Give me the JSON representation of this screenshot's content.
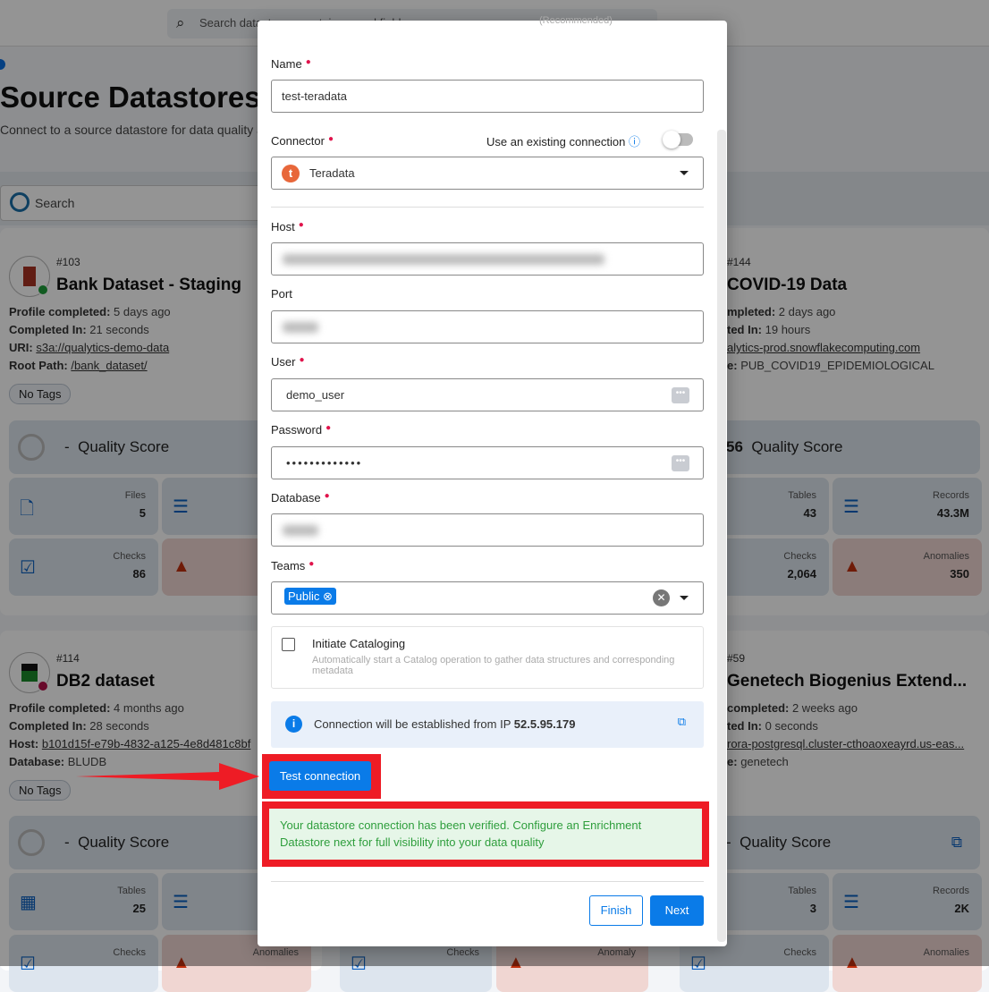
{
  "top_search_placeholder": "Search datastores, containers and fields",
  "page": {
    "title": "Source Datastores",
    "subtitle": "Connect to a source datastore for data quality a",
    "search_placeholder": "Search"
  },
  "cards": [
    {
      "id": "#103",
      "name": "Bank Dataset - Staging",
      "status_color": "#1e9e3a",
      "meta": [
        [
          "Profile completed:",
          "5 days ago"
        ],
        [
          "Completed In:",
          "21 seconds"
        ],
        [
          "URI:",
          "s3a://qualytics-demo-data"
        ],
        [
          "Root Path:",
          "/bank_dataset/"
        ]
      ],
      "tag": "No Tags",
      "quality": "-",
      "quality_label": "Quality Score",
      "tiles": [
        {
          "label": "Files",
          "value": "5",
          "icon": "file-icon"
        },
        {
          "label": "Checks",
          "value": "86",
          "icon": "check-icon"
        }
      ]
    },
    {
      "id": "#114",
      "name": "DB2 dataset",
      "status_color": "#b3124a",
      "meta": [
        [
          "Profile completed:",
          "4 months ago"
        ],
        [
          "Completed In:",
          "28 seconds"
        ],
        [
          "Host:",
          "b101d15f-e79b-4832-a125-4e8d481c8bf"
        ],
        [
          "Database:",
          "BLUDB"
        ]
      ],
      "tag": "No Tags",
      "quality": "-",
      "quality_label": "Quality Score",
      "tiles": [
        {
          "label": "Tables",
          "value": "25",
          "icon": "table-icon"
        },
        {
          "label": "Checks",
          "value": "",
          "icon": "check-icon"
        }
      ]
    },
    {
      "id": "#144",
      "name": "COVID-19 Data",
      "meta": [
        [
          "mpleted:",
          "2 days ago"
        ],
        [
          "ted In:",
          "19 hours"
        ],
        [
          "",
          "alytics-prod.snowflakecomputing.com"
        ],
        [
          "e:",
          "PUB_COVID19_EPIDEMIOLOGICAL"
        ]
      ],
      "quality": "56",
      "quality_label": "Quality Score",
      "tiles": [
        {
          "label": "Tables",
          "value": "43"
        },
        {
          "label": "Records",
          "value": "43.3M"
        },
        {
          "label": "Checks",
          "value": "2,064"
        },
        {
          "label": "Anomalies",
          "value": "350"
        }
      ]
    },
    {
      "id": "#59",
      "name": "Genetech Biogenius Extend...",
      "meta": [
        [
          "completed:",
          "2 weeks ago"
        ],
        [
          "ted In:",
          "0 seconds"
        ],
        [
          "",
          "rora-postgresql.cluster-cthoaoxeayrd.us-eas..."
        ],
        [
          "e:",
          "genetech"
        ]
      ],
      "quality": "-",
      "quality_label": "Quality Score",
      "tiles": [
        {
          "label": "Tables",
          "value": "3"
        },
        {
          "label": "Records",
          "value": "2K"
        },
        {
          "label": "Checks",
          "value": ""
        },
        {
          "label": "Anomalies",
          "value": ""
        }
      ]
    }
  ],
  "partial_labels": {
    "anomalies": "Anomalies",
    "anomaly": "Anomaly",
    "checks": "Checks",
    "an": "An"
  },
  "modal": {
    "recommended": "(Recommended)",
    "name_label": "Name",
    "name_value": "test-teradata",
    "connector_label": "Connector",
    "existing_conn_label": "Use an existing connection",
    "existing_conn_on": false,
    "connector_value": "Teradata",
    "connector_color": "#e8673a",
    "host_label": "Host",
    "port_label": "Port",
    "user_label": "User",
    "user_value": "demo_user",
    "password_label": "Password",
    "password_value": "•••••••••••••",
    "database_label": "Database",
    "teams_label": "Teams",
    "teams_chip": "Public",
    "catalog_title": "Initiate Cataloging",
    "catalog_desc": "Automatically start a Catalog operation to gather data structures and corresponding metadata",
    "catalog_checked": false,
    "ip_text": "Connection will be established from IP ",
    "ip_value": "52.5.95.179",
    "test_button": "Test connection",
    "success_msg": "Your datastore connection has been verified. Configure an Enrichment Datastore next for full visibility into your data quality",
    "finish_button": "Finish",
    "next_button": "Next"
  },
  "colors": {
    "primary": "#0a7be8",
    "success_bg": "#e6f6e8",
    "success_text": "#2e9e3c",
    "annotation": "#ee1c25"
  }
}
